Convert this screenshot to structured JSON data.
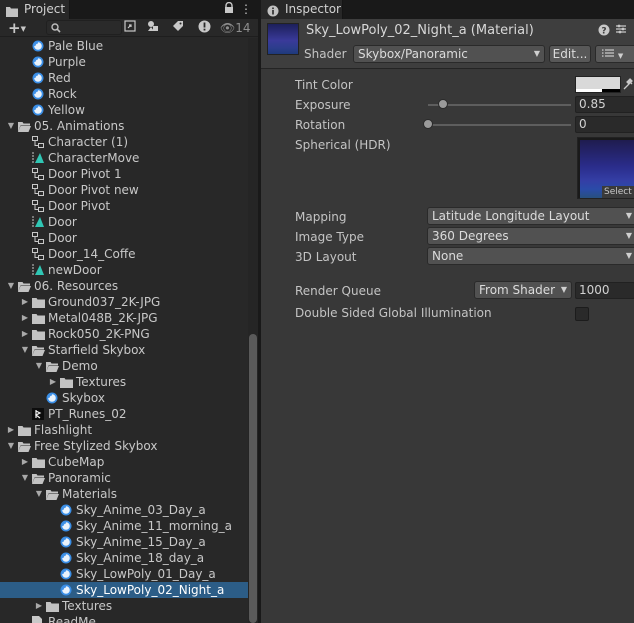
{
  "project": {
    "tab_title": "Project",
    "search_placeholder": "",
    "visible_count": "14",
    "tree": [
      {
        "label": "Pale Blue",
        "depth": 2,
        "type": "material",
        "arrow": ""
      },
      {
        "label": "Purple",
        "depth": 2,
        "type": "material",
        "arrow": ""
      },
      {
        "label": "Red",
        "depth": 2,
        "type": "material",
        "arrow": ""
      },
      {
        "label": "Rock",
        "depth": 2,
        "type": "material",
        "arrow": ""
      },
      {
        "label": "Yellow",
        "depth": 2,
        "type": "material",
        "arrow": ""
      },
      {
        "label": "05. Animations",
        "depth": 1,
        "type": "folder-open",
        "arrow": "down"
      },
      {
        "label": "Character (1)",
        "depth": 2,
        "type": "animator",
        "arrow": ""
      },
      {
        "label": "CharacterMove",
        "depth": 2,
        "type": "animation",
        "arrow": ""
      },
      {
        "label": "Door Pivot 1",
        "depth": 2,
        "type": "animator",
        "arrow": ""
      },
      {
        "label": "Door Pivot new",
        "depth": 2,
        "type": "animator",
        "arrow": ""
      },
      {
        "label": "Door Pivot",
        "depth": 2,
        "type": "animator",
        "arrow": ""
      },
      {
        "label": "Door",
        "depth": 2,
        "type": "animation",
        "arrow": ""
      },
      {
        "label": "Door",
        "depth": 2,
        "type": "animator",
        "arrow": ""
      },
      {
        "label": "Door_14_Coffe",
        "depth": 2,
        "type": "animator",
        "arrow": ""
      },
      {
        "label": "newDoor",
        "depth": 2,
        "type": "animation",
        "arrow": ""
      },
      {
        "label": "06. Resources",
        "depth": 1,
        "type": "folder-open",
        "arrow": "down"
      },
      {
        "label": "Ground037_2K-JPG",
        "depth": 2,
        "type": "folder",
        "arrow": "right"
      },
      {
        "label": "Metal048B_2K-JPG",
        "depth": 2,
        "type": "folder",
        "arrow": "right"
      },
      {
        "label": "Rock050_2K-PNG",
        "depth": 2,
        "type": "folder",
        "arrow": "right"
      },
      {
        "label": "Starfield Skybox",
        "depth": 2,
        "type": "folder-open",
        "arrow": "down"
      },
      {
        "label": "Demo",
        "depth": 3,
        "type": "folder-open",
        "arrow": "down"
      },
      {
        "label": "Textures",
        "depth": 4,
        "type": "folder",
        "arrow": "right"
      },
      {
        "label": "Skybox",
        "depth": 3,
        "type": "material",
        "arrow": ""
      },
      {
        "label": "PT_Runes_02",
        "depth": 2,
        "type": "script",
        "arrow": ""
      },
      {
        "label": "Flashlight",
        "depth": 1,
        "type": "folder",
        "arrow": "right"
      },
      {
        "label": "Free Stylized Skybox",
        "depth": 1,
        "type": "folder-open",
        "arrow": "down"
      },
      {
        "label": "CubeMap",
        "depth": 2,
        "type": "folder",
        "arrow": "right"
      },
      {
        "label": "Panoramic",
        "depth": 2,
        "type": "folder-open",
        "arrow": "down"
      },
      {
        "label": "Materials",
        "depth": 3,
        "type": "folder-open",
        "arrow": "down"
      },
      {
        "label": "Sky_Anime_03_Day_a",
        "depth": 4,
        "type": "material",
        "arrow": ""
      },
      {
        "label": "Sky_Anime_11_morning_a",
        "depth": 4,
        "type": "material",
        "arrow": ""
      },
      {
        "label": "Sky_Anime_15_Day_a",
        "depth": 4,
        "type": "material",
        "arrow": ""
      },
      {
        "label": "Sky_Anime_18_day_a",
        "depth": 4,
        "type": "material",
        "arrow": ""
      },
      {
        "label": "Sky_LowPoly_01_Day_a",
        "depth": 4,
        "type": "material",
        "arrow": ""
      },
      {
        "label": "Sky_LowPoly_02_Night_a",
        "depth": 4,
        "type": "material",
        "arrow": "",
        "selected": true
      },
      {
        "label": "Textures",
        "depth": 3,
        "type": "folder",
        "arrow": "right"
      },
      {
        "label": "ReadMe",
        "depth": 2,
        "type": "file",
        "arrow": ""
      }
    ]
  },
  "inspector": {
    "tab_title": "Inspector",
    "material_title": "Sky_LowPoly_02_Night_a (Material)",
    "shader_label": "Shader",
    "shader_value": "Skybox/Panoramic",
    "edit_button": "Edit...",
    "properties": {
      "tint_color_label": "Tint Color",
      "exposure_label": "Exposure",
      "exposure_value": "0.85",
      "exposure_fraction": 0.106,
      "rotation_label": "Rotation",
      "rotation_value": "0",
      "rotation_fraction": 0.0,
      "spherical_label": "Spherical  (HDR)",
      "texture_select": "Select",
      "mapping_label": "Mapping",
      "mapping_value": "Latitude Longitude Layout",
      "image_type_label": "Image Type",
      "image_type_value": "360 Degrees",
      "layout_3d_label": "3D Layout",
      "layout_3d_value": "None",
      "render_queue_label": "Render Queue",
      "render_queue_source": "From Shader",
      "render_queue_value": "1000",
      "double_sided_label": "Double Sided Global Illumination",
      "double_sided_checked": false
    }
  },
  "colors": {
    "selection": "#2c5d87",
    "panel": "#282828",
    "inspector": "#383838",
    "folder": "#c2c2c2",
    "material_blue": "#3a8ee6"
  }
}
